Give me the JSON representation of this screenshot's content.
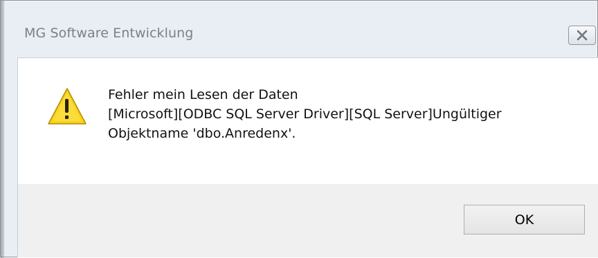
{
  "window": {
    "title": "MG Software Entwicklung"
  },
  "title_bar": {
    "close_icon": "close-icon"
  },
  "dialog": {
    "icon": "warning-icon",
    "message_lines": [
      "Fehler mein Lesen der Daten",
      "[Microsoft][ODBC SQL Server Driver][SQL Server]Ungültiger",
      "Objektname 'dbo.Anredenx'."
    ]
  },
  "buttons": {
    "ok_label": "OK"
  },
  "colors": {
    "warning_fill": "#f6d21a",
    "title_text": "#7b8088",
    "button_bar": "#f0f0f0"
  }
}
